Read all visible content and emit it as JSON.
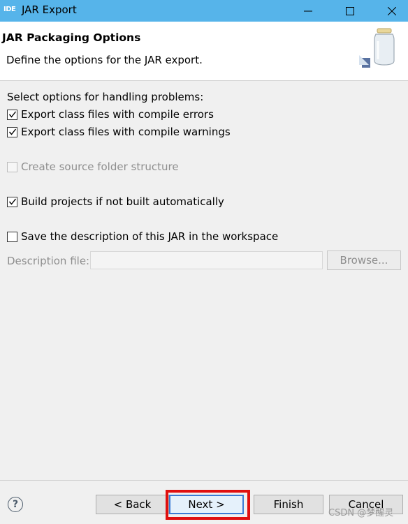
{
  "window": {
    "app_icon": "IDE",
    "title": "JAR Export"
  },
  "header": {
    "title": "JAR Packaging Options",
    "description": "Define the options for the JAR export."
  },
  "options": {
    "heading": "Select options for handling problems:",
    "export_errors": {
      "label": "Export class files with compile errors",
      "checked": true
    },
    "export_warnings": {
      "label": "Export class files with compile warnings",
      "checked": true
    },
    "source_folder": {
      "label": "Create source folder structure",
      "checked": false,
      "disabled": true
    },
    "build_projects": {
      "label": "Build projects if not built automatically",
      "checked": true
    },
    "save_description": {
      "label": "Save the description of this JAR in the workspace",
      "checked": false
    }
  },
  "description_file": {
    "label": "Description file:",
    "value": "",
    "browse_label": "Browse..."
  },
  "footer": {
    "help": "?",
    "back": "< Back",
    "next": "Next >",
    "finish": "Finish",
    "cancel": "Cancel"
  },
  "watermark": "CSDN @梦醒灵",
  "colors": {
    "titlebar": "#56b4ea",
    "highlight": "#e01010"
  }
}
